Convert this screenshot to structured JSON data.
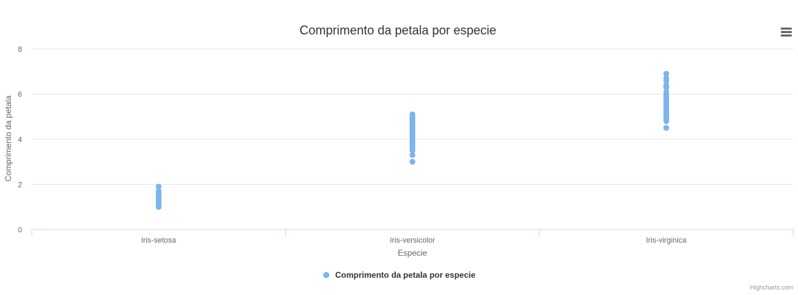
{
  "chart_data": {
    "type": "scatter",
    "title": "Comprimento da petala por especie",
    "xlabel": "Especie",
    "ylabel": "Comprimento da petala",
    "categories": [
      "Iris-setosa",
      "Iris-versicolor",
      "Iris-virginica"
    ],
    "ylim": [
      0,
      8
    ],
    "yticks": [
      0,
      2,
      4,
      6,
      8
    ],
    "grid": true,
    "legend_position": "bottom-center",
    "series": [
      {
        "name": "Comprimento da petala por especie",
        "color": "#7cb5ec",
        "points": [
          {
            "category": "Iris-setosa",
            "values": [
              1.0,
              1.1,
              1.2,
              1.3,
              1.4,
              1.5,
              1.6,
              1.7,
              1.9
            ]
          },
          {
            "category": "Iris-versicolor",
            "values": [
              3.0,
              3.3,
              3.5,
              3.6,
              3.7,
              3.8,
              3.9,
              4.0,
              4.1,
              4.2,
              4.3,
              4.4,
              4.5,
              4.6,
              4.7,
              4.8,
              4.9,
              5.0,
              5.1
            ]
          },
          {
            "category": "Iris-virginica",
            "values": [
              4.5,
              4.8,
              4.9,
              5.0,
              5.1,
              5.2,
              5.3,
              5.4,
              5.5,
              5.6,
              5.7,
              5.8,
              5.9,
              6.0,
              6.1,
              6.3,
              6.4,
              6.6,
              6.7,
              6.9
            ]
          }
        ]
      }
    ]
  },
  "credits": "Highcharts.com",
  "menu": {
    "icon": "hamburger-menu-icon",
    "icon_color": "#666666"
  },
  "colors": {
    "gridline": "#e6e6e6",
    "axis_line": "#ccd6eb"
  }
}
